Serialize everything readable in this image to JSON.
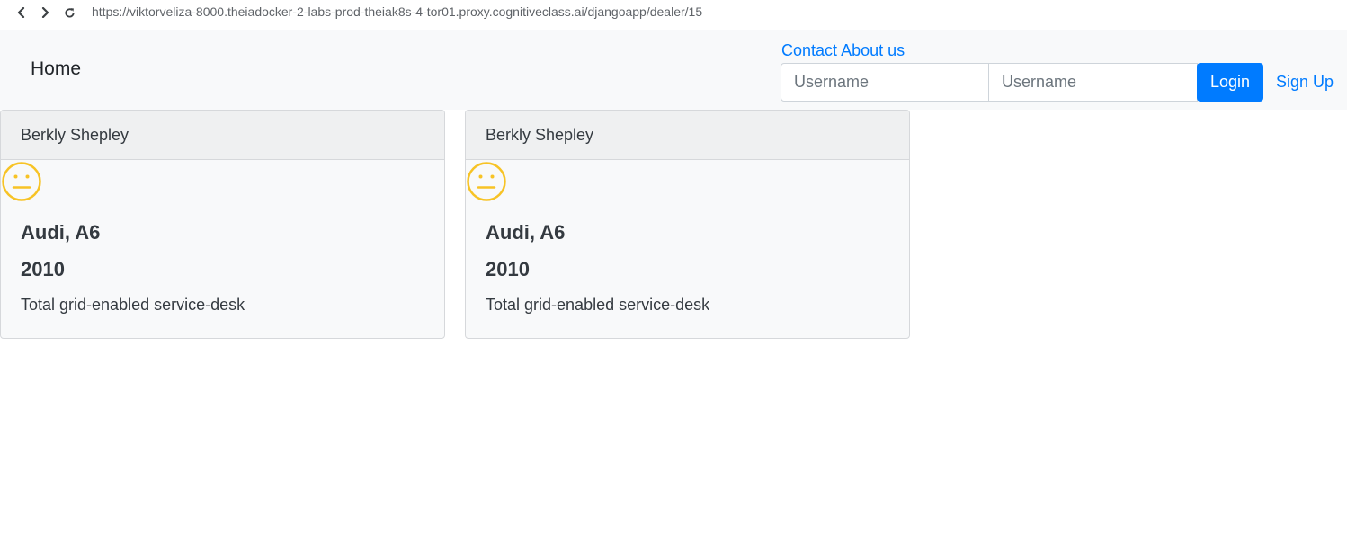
{
  "browser": {
    "url": "https://viktorveliza-8000.theiadocker-2-labs-prod-theiak8s-4-tor01.proxy.cognitiveclass.ai/djangoapp/dealer/15"
  },
  "navbar": {
    "brand": "Home",
    "links": {
      "contact": "Contact",
      "about": "About us"
    },
    "login": {
      "username_placeholder": "Username",
      "password_placeholder": "Username",
      "login_label": "Login",
      "signup_label": "Sign Up"
    }
  },
  "reviews": [
    {
      "reviewer": "Berkly Shepley",
      "sentiment": "neutral",
      "car": "Audi, A6",
      "year": "2010",
      "review": "Total grid-enabled service-desk"
    },
    {
      "reviewer": "Berkly Shepley",
      "sentiment": "neutral",
      "car": "Audi, A6",
      "year": "2010",
      "review": "Total grid-enabled service-desk"
    }
  ],
  "colors": {
    "primary": "#007bff",
    "navbar_bg": "#f8f9fa",
    "sentiment_neutral": "#f7c325"
  }
}
